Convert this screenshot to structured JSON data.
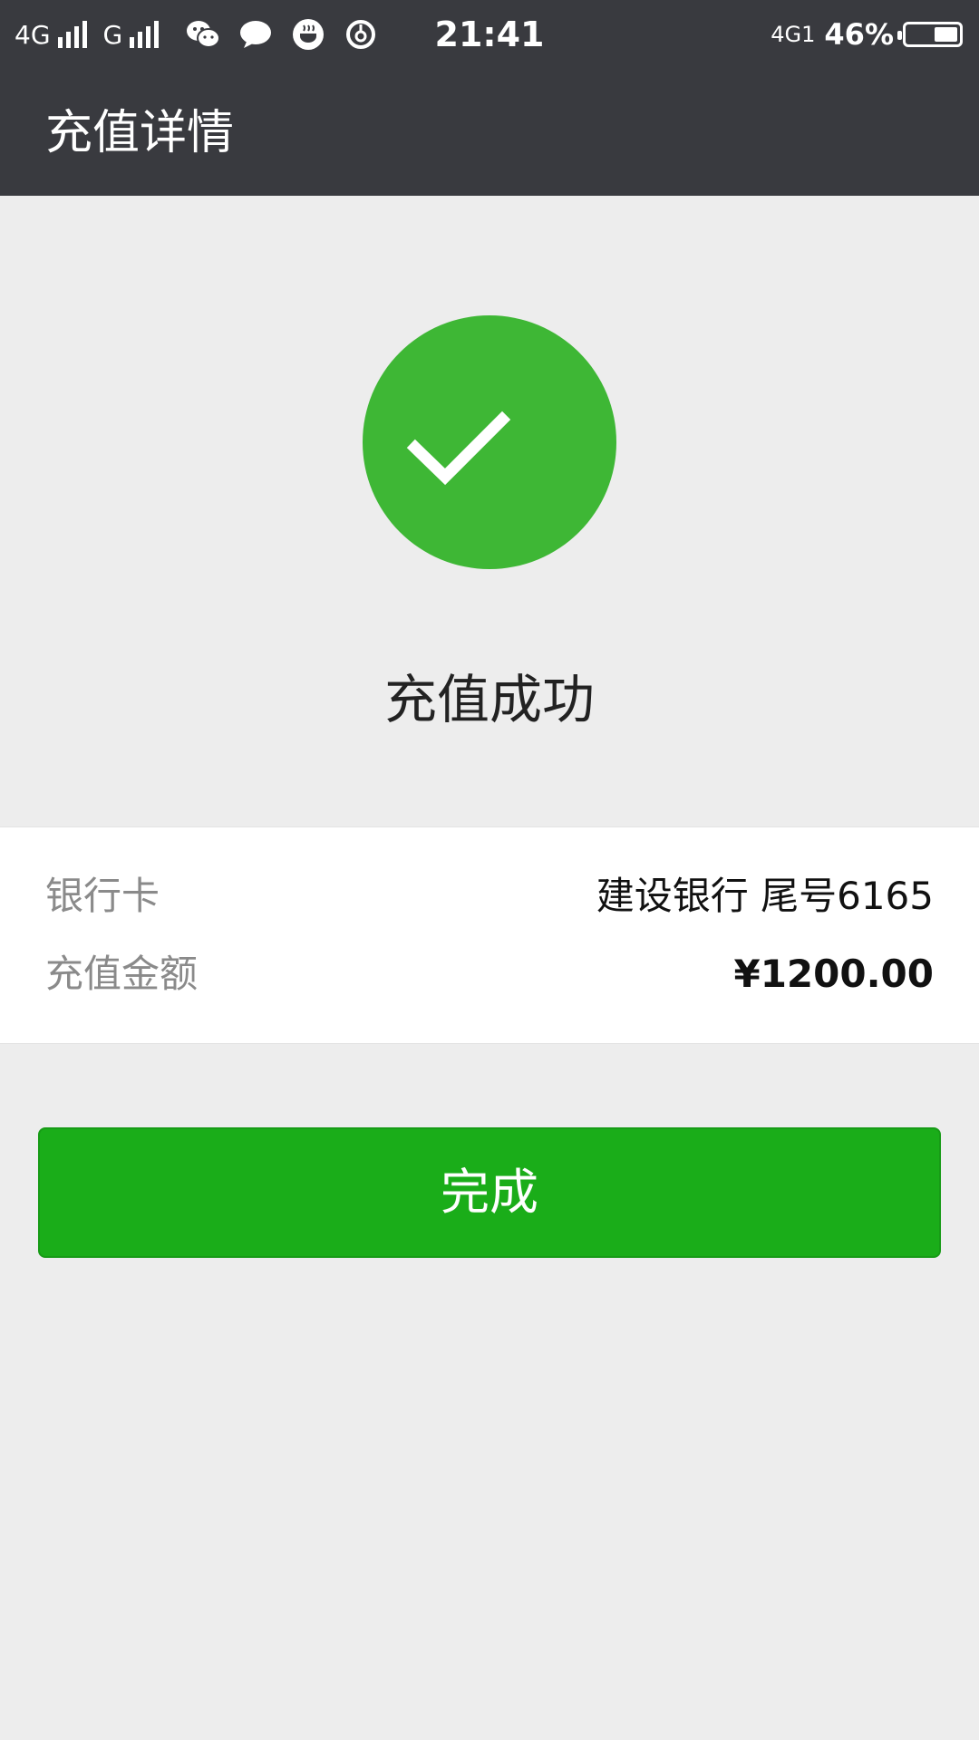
{
  "status_bar": {
    "network_left_1": "4G",
    "network_left_2": "G",
    "app_icons": [
      "wechat-icon",
      "chat-bubble-icon",
      "coffee-icon",
      "netease-music-icon"
    ],
    "time": "21:41",
    "network_right": "4G1",
    "battery_percent": "46%",
    "battery_level": 0.46
  },
  "header": {
    "title": "充值详情"
  },
  "result": {
    "icon": "checkmark-icon",
    "message": "充值成功",
    "accent_color": "#3eb735"
  },
  "details": {
    "rows": [
      {
        "label": "银行卡",
        "value": "建设银行 尾号6165"
      },
      {
        "label": "充值金额",
        "value": "¥1200.00"
      }
    ]
  },
  "actions": {
    "done_label": "完成",
    "done_color": "#1aad19"
  }
}
